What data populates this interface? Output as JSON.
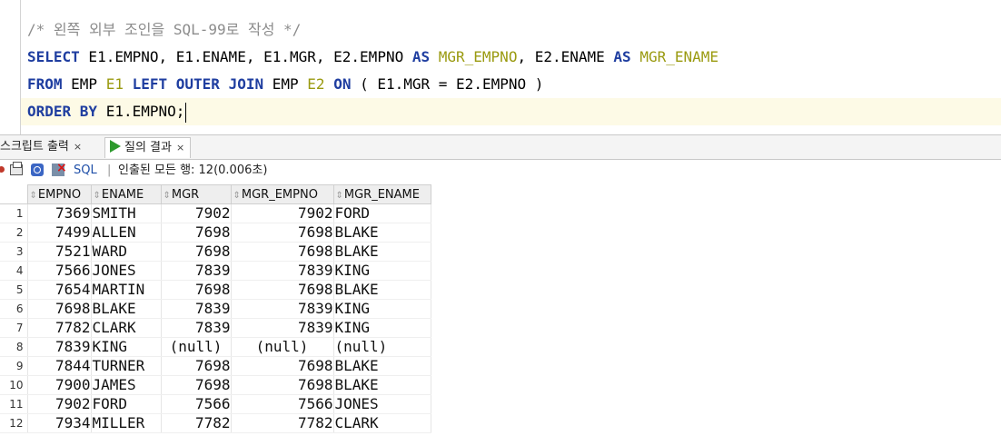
{
  "editor": {
    "comment": "/* 왼쪽 외부 조인을 SQL-99로 작성 */",
    "line2": [
      {
        "t": "SELECT",
        "k": "kw"
      },
      {
        "t": " E1.EMPNO, E1.ENAME, E1.MGR, E2.EMPNO ",
        "k": ""
      },
      {
        "t": "AS",
        "k": "kw"
      },
      {
        "t": " ",
        "k": ""
      },
      {
        "t": "MGR_EMPNO",
        "k": "alias"
      },
      {
        "t": ", E2.ENAME ",
        "k": ""
      },
      {
        "t": "AS",
        "k": "kw"
      },
      {
        "t": " ",
        "k": ""
      },
      {
        "t": "MGR_ENAME",
        "k": "alias"
      }
    ],
    "line3": [
      {
        "t": "FROM",
        "k": "kw"
      },
      {
        "t": " EMP ",
        "k": ""
      },
      {
        "t": "E1",
        "k": "alias"
      },
      {
        "t": " ",
        "k": ""
      },
      {
        "t": "LEFT OUTER JOIN",
        "k": "kw"
      },
      {
        "t": " EMP ",
        "k": ""
      },
      {
        "t": "E2",
        "k": "alias"
      },
      {
        "t": " ",
        "k": ""
      },
      {
        "t": "ON",
        "k": "kw"
      },
      {
        "t": " ( E1.MGR = E2.EMPNO )",
        "k": ""
      }
    ],
    "line4": [
      {
        "t": "ORDER BY",
        "k": "kw"
      },
      {
        "t": " E1.EMPNO;",
        "k": ""
      }
    ]
  },
  "tabs": {
    "script_output": "스크립트 출력",
    "query_result": "질의 결과",
    "close_glyph": "×"
  },
  "toolbar": {
    "sql_label": "SQL",
    "separator": "|",
    "status": "인출된 모든 행: 12(0.006초)"
  },
  "grid": {
    "columns": [
      "EMPNO",
      "ENAME",
      "MGR",
      "MGR_EMPNO",
      "MGR_ENAME"
    ],
    "sort_glyph": "⇕",
    "rows": [
      [
        "1",
        "7369",
        "SMITH",
        "7902",
        "7902",
        "FORD"
      ],
      [
        "2",
        "7499",
        "ALLEN",
        "7698",
        "7698",
        "BLAKE"
      ],
      [
        "3",
        "7521",
        "WARD",
        "7698",
        "7698",
        "BLAKE"
      ],
      [
        "4",
        "7566",
        "JONES",
        "7839",
        "7839",
        "KING"
      ],
      [
        "5",
        "7654",
        "MARTIN",
        "7698",
        "7698",
        "BLAKE"
      ],
      [
        "6",
        "7698",
        "BLAKE",
        "7839",
        "7839",
        "KING"
      ],
      [
        "7",
        "7782",
        "CLARK",
        "7839",
        "7839",
        "KING"
      ],
      [
        "8",
        "7839",
        "KING",
        "(null)",
        "(null)",
        "(null)"
      ],
      [
        "9",
        "7844",
        "TURNER",
        "7698",
        "7698",
        "BLAKE"
      ],
      [
        "10",
        "7900",
        "JAMES",
        "7698",
        "7698",
        "BLAKE"
      ],
      [
        "11",
        "7902",
        "FORD",
        "7566",
        "7566",
        "JONES"
      ],
      [
        "12",
        "7934",
        "MILLER",
        "7782",
        "7782",
        "CLARK"
      ]
    ]
  },
  "colors": {
    "keyword": "#1f3ea0",
    "alias": "#9a9a10",
    "comment": "#8c8c8c",
    "current_line": "#fdfae6",
    "run_icon": "#2e9a2e"
  }
}
